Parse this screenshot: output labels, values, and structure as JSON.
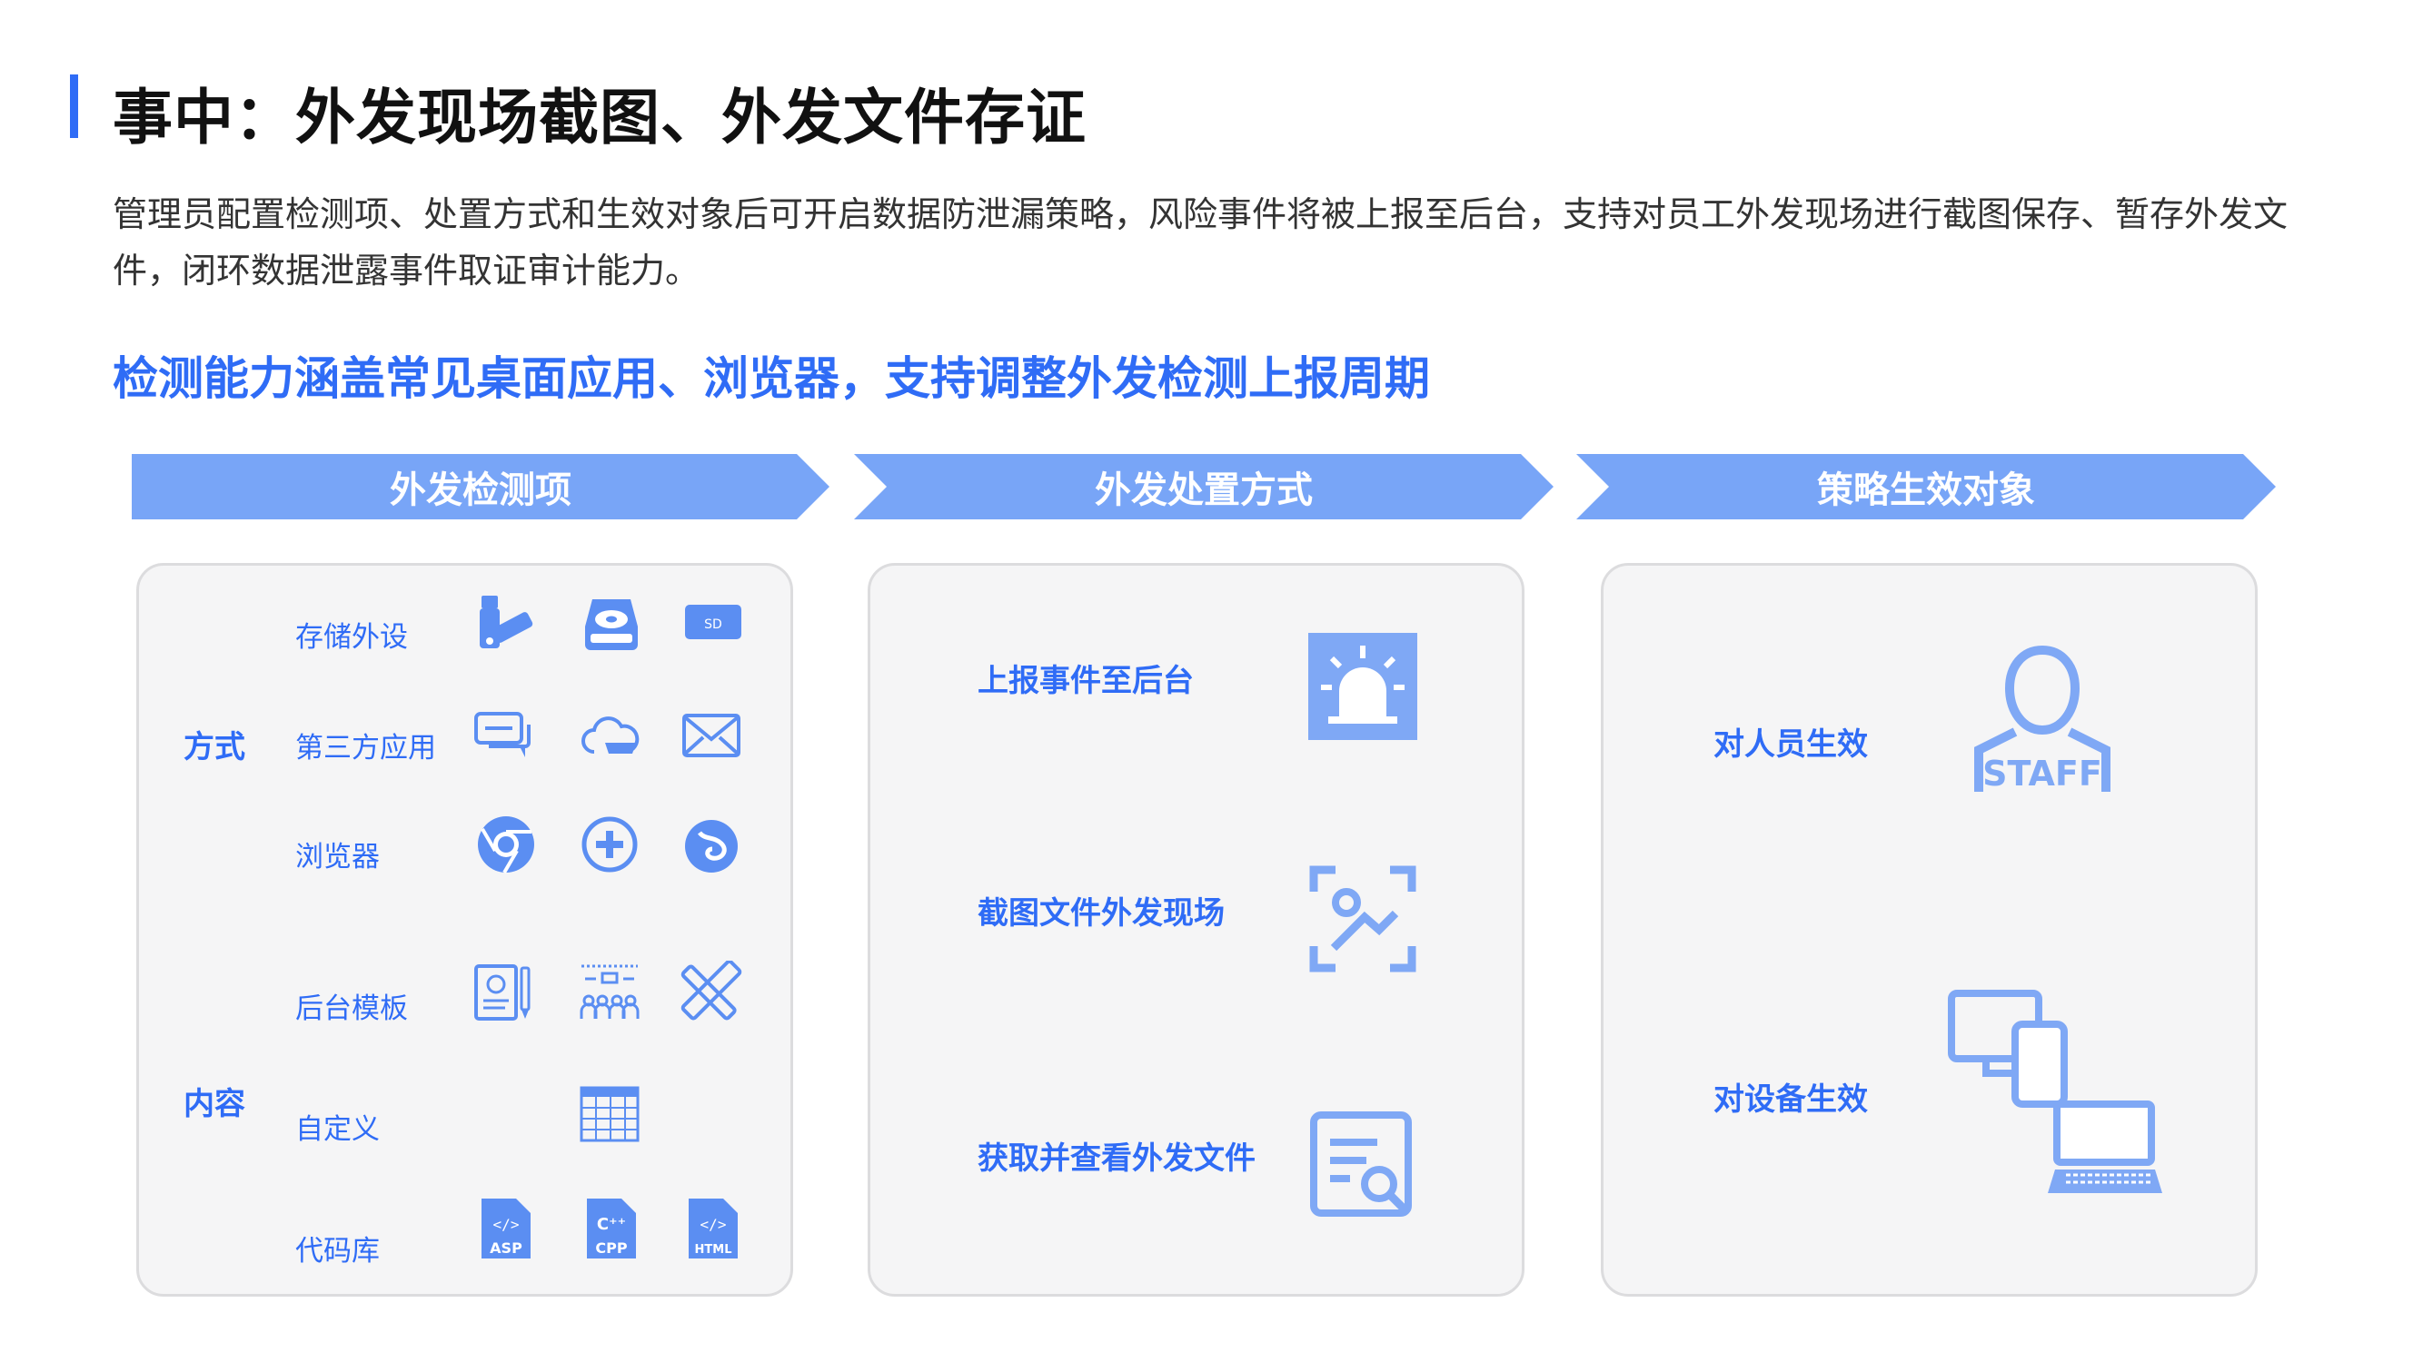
{
  "header": {
    "title": "事中：外发现场截图、外发文件存证",
    "description": "管理员配置检测项、处置方式和生效对象后可开启数据防泄漏策略，风险事件将被上报至后台，支持对员工外发现场进行截图保存、暂存外发文件，闭环数据泄露事件取证审计能力。",
    "subtitle": "检测能力涵盖常见桌面应用、浏览器，支持调整外发检测上报周期"
  },
  "steps": [
    "外发检测项",
    "外发处置方式",
    "策略生效对象"
  ],
  "detection": {
    "method_label": "方式",
    "content_label": "内容",
    "method_items": [
      {
        "label": "存储外设",
        "icons": [
          "usb-drive-icon",
          "hard-disk-icon",
          "sd-card-icon"
        ]
      },
      {
        "label": "第三方应用",
        "icons": [
          "chat-bubbles-icon",
          "cloud-icon",
          "mail-icon"
        ]
      },
      {
        "label": "浏览器",
        "icons": [
          "chrome-icon",
          "plus-circle-browser-icon",
          "firefox-icon"
        ]
      }
    ],
    "content_items": [
      {
        "label": "后台模板",
        "icons": [
          "certificate-icon",
          "org-chart-icon",
          "design-tools-icon"
        ]
      },
      {
        "label": "自定义",
        "icons": [
          "table-grid-icon"
        ]
      },
      {
        "label": "代码库",
        "icons": [
          "asp-file-icon",
          "cpp-file-icon",
          "html-file-icon"
        ]
      }
    ],
    "sd_text": "SD",
    "asp_text": "ASP",
    "cpp_text": "CPP",
    "html_text": "HTML"
  },
  "disposal": {
    "items": [
      {
        "label": "上报事件至后台",
        "icon": "alarm-icon"
      },
      {
        "label": "截图文件外发现场",
        "icon": "screenshot-icon"
      },
      {
        "label": "获取并查看外发文件",
        "icon": "file-search-icon"
      }
    ]
  },
  "targets": {
    "items": [
      {
        "label": "对人员生效",
        "icon": "staff-icon"
      },
      {
        "label": "对设备生效",
        "icon": "devices-icon"
      }
    ],
    "staff_text": "STAFF"
  },
  "colors": {
    "accent": "#2f6cf6",
    "arrow": "#78a5f7",
    "icon": "#5b8ef2"
  }
}
